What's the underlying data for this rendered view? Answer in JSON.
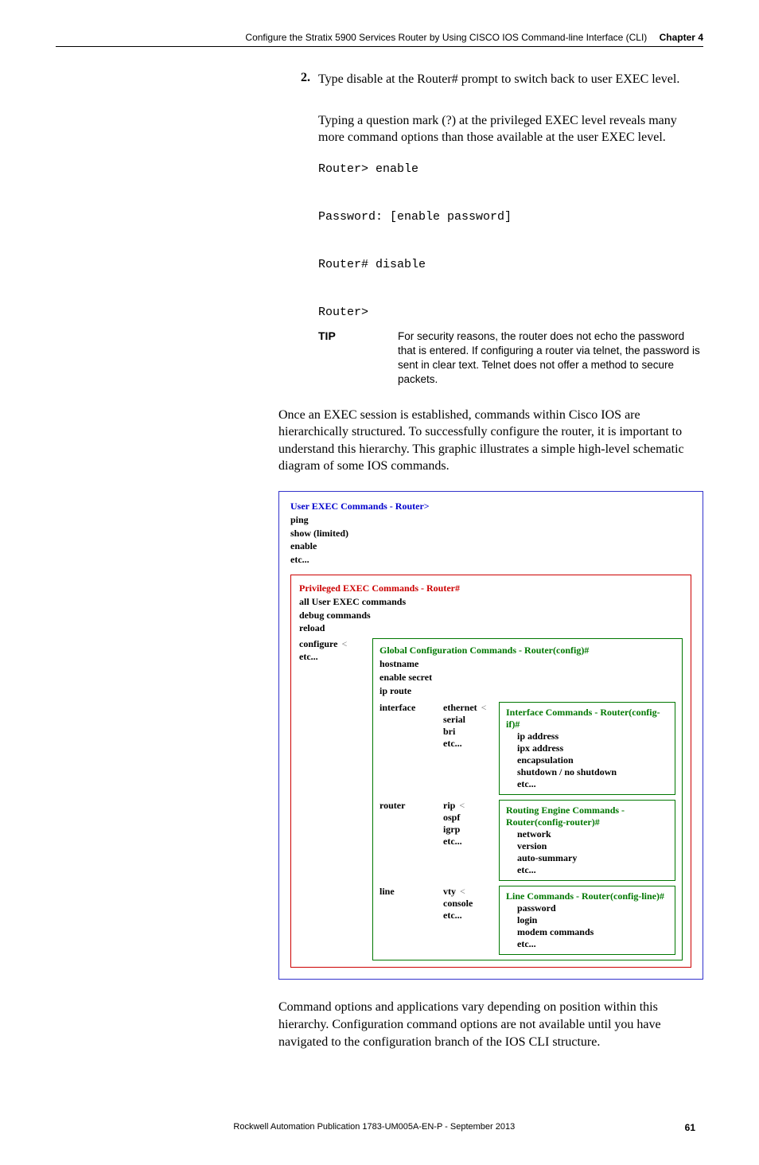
{
  "header": {
    "title": "Configure the Stratix 5900 Services Router by Using CISCO IOS Command-line Interface (CLI)",
    "chapter": "Chapter 4"
  },
  "step2": {
    "number": "2.",
    "text": "Type disable at the Router# prompt to switch back to user EXEC level.",
    "followup": "Typing a question mark (?) at the privileged EXEC level reveals many more command options than those available at the user EXEC level."
  },
  "code": "Router> enable\n\nPassword: [enable password]\n\nRouter# disable\n\nRouter>",
  "tip": {
    "label": "TIP",
    "text": "For security reasons, the router does not echo the password that is entered. If configuring a router via telnet, the password is sent in clear text. Telnet does not offer a method to secure packets."
  },
  "para1": "Once an EXEC session is established, commands within Cisco IOS are hierarchically structured. To successfully configure the router, it is important to understand this hierarchy. This graphic illustrates a simple high-level schematic diagram of some IOS commands.",
  "diagram": {
    "user_exec": {
      "title": "User EXEC Commands - Router>",
      "items": [
        "ping",
        "show (limited)",
        "enable",
        "etc..."
      ]
    },
    "priv_exec": {
      "title": "Privileged EXEC Commands - Router#",
      "items": [
        "all User EXEC commands",
        "debug commands",
        "reload"
      ],
      "configure": "configure",
      "etc": "etc...",
      "global": {
        "title": "Global Configuration Commands - Router(config)#",
        "items": [
          "hostname",
          "enable secret",
          "ip route"
        ],
        "interface": {
          "keyword": "interface",
          "types": [
            "ethernet",
            "serial",
            "bri",
            "etc..."
          ],
          "box_title": "Interface Commands - Router(config-if)#",
          "box_items": [
            "ip address",
            "ipx address",
            "encapsulation",
            "shutdown / no shutdown",
            "etc..."
          ]
        },
        "router": {
          "keyword": "router",
          "types": [
            "rip",
            "ospf",
            "igrp",
            "etc..."
          ],
          "box_title": "Routing Engine Commands - Router(config-router)#",
          "box_items": [
            "network",
            "version",
            "auto-summary",
            "etc..."
          ]
        },
        "line": {
          "keyword": "line",
          "types": [
            "vty",
            "console",
            "etc..."
          ],
          "box_title": "Line Commands - Router(config-line)#",
          "box_items": [
            "password",
            "login",
            "modem commands",
            "etc..."
          ]
        }
      }
    }
  },
  "para2": "Command options and applications vary depending on position within this hierarchy. Configuration command options are not available until you have navigated to the configuration branch of the IOS CLI structure.",
  "footer": {
    "pub": "Rockwell Automation Publication 1783-UM005A-EN-P - September 2013",
    "page": "61"
  }
}
